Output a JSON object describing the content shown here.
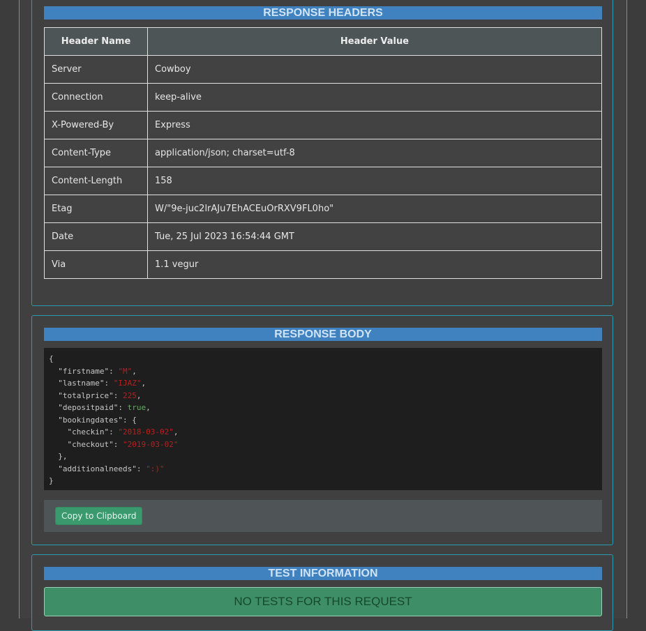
{
  "response_headers": {
    "title": "RESPONSE HEADERS",
    "columns": [
      "Header Name",
      "Header Value"
    ],
    "rows": [
      {
        "name": "Server",
        "value": "Cowboy"
      },
      {
        "name": "Connection",
        "value": "keep-alive"
      },
      {
        "name": "X-Powered-By",
        "value": "Express"
      },
      {
        "name": "Content-Type",
        "value": "application/json; charset=utf-8"
      },
      {
        "name": "Content-Length",
        "value": "158"
      },
      {
        "name": "Etag",
        "value": "W/\"9e-juc2lrAJu7EhACEuOrRXV9FL0ho\""
      },
      {
        "name": "Date",
        "value": "Tue, 25 Jul 2023 16:54:44 GMT"
      },
      {
        "name": "Via",
        "value": "1.1 vegur"
      }
    ]
  },
  "response_body": {
    "title": "RESPONSE BODY",
    "json": {
      "open": "{",
      "firstname_key": "\"firstname\"",
      "firstname_val": "\"M\"",
      "lastname_key": "\"lastname\"",
      "lastname_val": "\"IJAZ\"",
      "totalprice_key": "\"totalprice\"",
      "totalprice_val": "225",
      "depositpaid_key": "\"depositpaid\"",
      "depositpaid_val": "true",
      "bookingdates_key": "\"bookingdates\"",
      "checkin_key": "\"checkin\"",
      "checkin_val": "\"2018-03-02\"",
      "checkout_key": "\"checkout\"",
      "checkout_val": "\"2019-03-02\"",
      "additionalneeds_key": "\"additionalneeds\"",
      "additionalneeds_val": "\":)\"",
      "close": "}"
    },
    "copy_label": "Copy to Clipboard"
  },
  "test_information": {
    "title": "TEST INFORMATION",
    "message": "NO TESTS FOR THIS REQUEST"
  },
  "colors": {
    "section_bar": "#3f82bf",
    "panel_border": "#2a9bb0",
    "copy_button": "#3a9a6e",
    "no_tests_bg": "#3e8e68"
  }
}
